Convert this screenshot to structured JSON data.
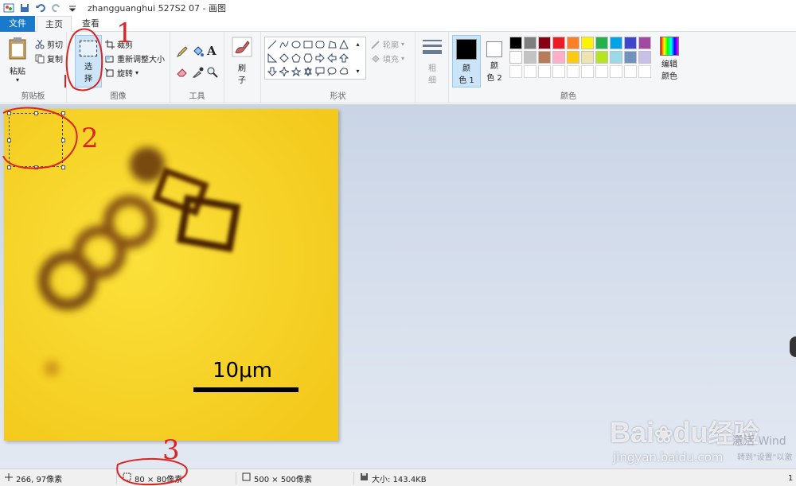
{
  "titlebar": {
    "title": "zhangguanghui 527S2 07 - 画图"
  },
  "tabs": {
    "file": "文件",
    "home": "主页",
    "view": "查看"
  },
  "clipboard": {
    "paste": "粘贴",
    "cut": "剪切",
    "copy": "复制",
    "group_label": "剪贴板"
  },
  "image": {
    "select_line1": "选",
    "select_line2": "择",
    "crop": "裁剪",
    "resize": "重新调整大小",
    "rotate": "旋转",
    "group_label": "图像"
  },
  "tools": {
    "group_label": "工具",
    "text_tool": "A"
  },
  "brush": {
    "line1": "刷",
    "line2": "子"
  },
  "shapes": {
    "outline": "轮廓",
    "fill": "填充",
    "group_label": "形状"
  },
  "size": {
    "line1": "粗",
    "line2": "细"
  },
  "colors": {
    "color1_line1": "颜",
    "color1_line2": "色 1",
    "color2_line1": "颜",
    "color2_line2": "色 2",
    "edit_line1": "编辑",
    "edit_line2": "颜色",
    "group_label": "颜色",
    "palette_row1": [
      "#000000",
      "#7f7f7f",
      "#880015",
      "#ed1c24",
      "#ff7f27",
      "#fff200",
      "#22b14c",
      "#00a2e8",
      "#3f48cc",
      "#a349a4"
    ],
    "palette_row2": [
      "#ffffff",
      "#c3c3c3",
      "#b97a57",
      "#ffaec9",
      "#ffc90e",
      "#efe4b0",
      "#b5e61d",
      "#99d9ea",
      "#7092be",
      "#c8bfe7"
    ]
  },
  "canvas": {
    "scale_label": "10μm"
  },
  "status": {
    "cursor_pos": "266, 97像素",
    "selection_size": "80 × 80像素",
    "image_size": "500 × 500像素",
    "file_size": "大小: 143.4KB",
    "right_edge": "1"
  },
  "annotations": {
    "n1": "1",
    "n2": "2",
    "n3": "3"
  },
  "watermark": {
    "brand": "Bai",
    "brand2": "du",
    "brand_cn": "经验",
    "url": "jingyan.baidu.com",
    "activate": "激活 Wind",
    "activate_sub": "转到\"设置\"以激"
  }
}
